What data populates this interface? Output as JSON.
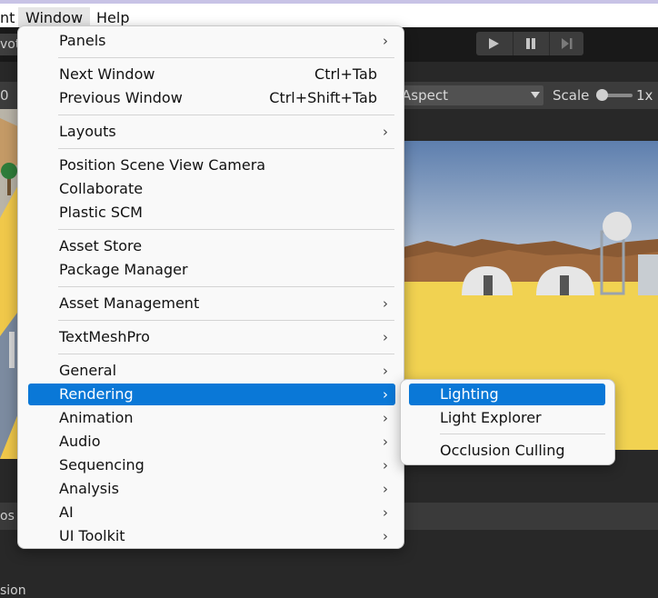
{
  "menubar": {
    "items": [
      {
        "id": "prev",
        "label": "nt"
      },
      {
        "id": "window",
        "label": "Window"
      },
      {
        "id": "help",
        "label": "Help"
      }
    ]
  },
  "toolbar": {
    "pivot_label": "vot",
    "play_icons": [
      "play-icon",
      "pause-icon",
      "step-icon"
    ]
  },
  "game_header": {
    "aspect_label": "Aspect",
    "scale_label": "Scale",
    "scale_value": "1x",
    "scale_fraction": 0.0
  },
  "left_tab_label": "0",
  "bottom": {
    "tab_label": "os",
    "footer_label": "sion"
  },
  "window_menu": {
    "items": [
      {
        "label": "Panels",
        "shortcut": "",
        "submenu": true
      },
      {
        "label": "Next Window",
        "shortcut": "Ctrl+Tab",
        "submenu": false
      },
      {
        "label": "Previous Window",
        "shortcut": "Ctrl+Shift+Tab",
        "submenu": false
      },
      {
        "label": "Layouts",
        "shortcut": "",
        "submenu": true
      },
      {
        "label": "Position Scene View Camera",
        "shortcut": "",
        "submenu": false
      },
      {
        "label": "Collaborate",
        "shortcut": "",
        "submenu": false
      },
      {
        "label": "Plastic SCM",
        "shortcut": "",
        "submenu": false
      },
      {
        "label": "Asset Store",
        "shortcut": "",
        "submenu": false
      },
      {
        "label": "Package Manager",
        "shortcut": "",
        "submenu": false
      },
      {
        "label": "Asset Management",
        "shortcut": "",
        "submenu": true
      },
      {
        "label": "TextMeshPro",
        "shortcut": "",
        "submenu": true
      },
      {
        "label": "General",
        "shortcut": "",
        "submenu": true
      },
      {
        "label": "Rendering",
        "shortcut": "",
        "submenu": true,
        "selected": true
      },
      {
        "label": "Animation",
        "shortcut": "",
        "submenu": true
      },
      {
        "label": "Audio",
        "shortcut": "",
        "submenu": true
      },
      {
        "label": "Sequencing",
        "shortcut": "",
        "submenu": true
      },
      {
        "label": "Analysis",
        "shortcut": "",
        "submenu": true
      },
      {
        "label": "AI",
        "shortcut": "",
        "submenu": true
      },
      {
        "label": "UI Toolkit",
        "shortcut": "",
        "submenu": true
      }
    ]
  },
  "rendering_submenu": {
    "items": [
      {
        "label": "Lighting",
        "selected": true
      },
      {
        "label": "Light Explorer"
      },
      {
        "label": "Occlusion Culling"
      }
    ]
  },
  "colors": {
    "selection": "#0a78d7",
    "menu_bg": "#f9f9f9",
    "editor_bg": "#282828"
  }
}
